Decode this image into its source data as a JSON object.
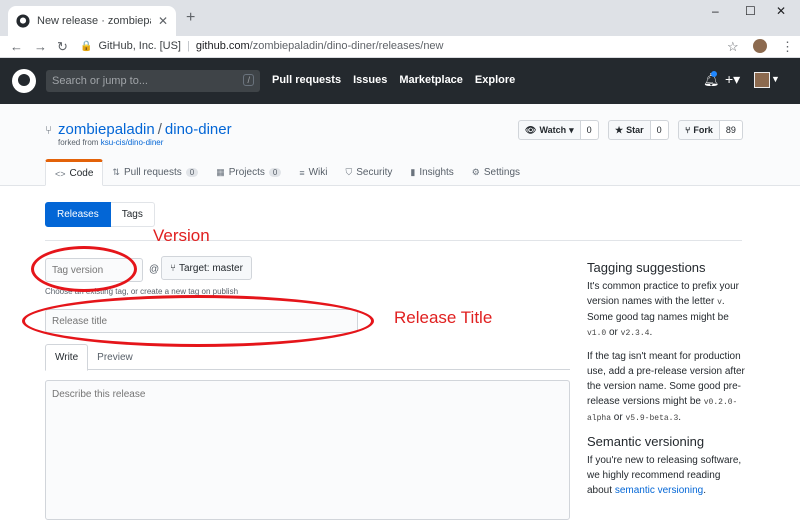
{
  "browser": {
    "tab_title": "New release · zombiepaladin/dino",
    "new_tab_icon": "plus-icon",
    "window_controls": [
      "–",
      "☐",
      "✕"
    ],
    "cert_owner": "GitHub, Inc. [US]",
    "url_host": "github.com",
    "url_path": "/zombiepaladin/dino-diner/releases/new"
  },
  "gh_header": {
    "search_placeholder": "Search or jump to...",
    "slash_key": "/",
    "nav": [
      "Pull requests",
      "Issues",
      "Marketplace",
      "Explore"
    ]
  },
  "repo": {
    "owner": "zombiepaladin",
    "separator": "/",
    "name": "dino-diner",
    "forked_prefix": "forked from ",
    "forked_source": "ksu-cis/dino-diner",
    "watch_label": "Watch",
    "watch_count": "0",
    "star_label": "Star",
    "star_count": "0",
    "fork_label": "Fork",
    "fork_count": "89"
  },
  "reponav": [
    {
      "icon": "<>",
      "label": "Code",
      "count": ""
    },
    {
      "icon": "⇅",
      "label": "Pull requests",
      "count": "0"
    },
    {
      "icon": "▦",
      "label": "Projects",
      "count": "0"
    },
    {
      "icon": "≡",
      "label": "Wiki",
      "count": ""
    },
    {
      "icon": "⛉",
      "label": "Security",
      "count": ""
    },
    {
      "icon": "▮",
      "label": "Insights",
      "count": ""
    },
    {
      "icon": "⚙",
      "label": "Settings",
      "count": ""
    }
  ],
  "subnav": {
    "releases": "Releases",
    "tags": "Tags"
  },
  "form": {
    "tag_placeholder": "Tag version",
    "at_symbol": "@",
    "target_label": "Target: master",
    "tag_note": "Choose an existing tag, or create a new tag on publish",
    "title_placeholder": "Release title",
    "write_tab": "Write",
    "preview_tab": "Preview",
    "body_placeholder": "Describe this release"
  },
  "sidebar": {
    "tagging_heading": "Tagging suggestions",
    "tagging_p1_a": "It's common practice to prefix your version names with the letter ",
    "tagging_p1_code1": "v",
    "tagging_p1_b": ". Some good tag names might be ",
    "tagging_p1_code2": "v1.0",
    "tagging_p1_c": " or ",
    "tagging_p1_code3": "v2.3.4",
    "tagging_p1_d": ".",
    "tagging_p2_a": "If the tag isn't meant for production use, add a pre-release version after the version name. Some good pre-release versions might be ",
    "tagging_p2_code1": "v0.2.0-alpha",
    "tagging_p2_b": " or ",
    "tagging_p2_code2": "v5.9-beta.3",
    "tagging_p2_c": ".",
    "semver_heading": "Semantic versioning",
    "semver_a": "If you're new to releasing software, we highly recommend reading about ",
    "semver_link": "semantic versioning",
    "semver_b": "."
  },
  "annotations": {
    "version": "Version",
    "release_title": "Release Title",
    "color": "#e02020"
  }
}
